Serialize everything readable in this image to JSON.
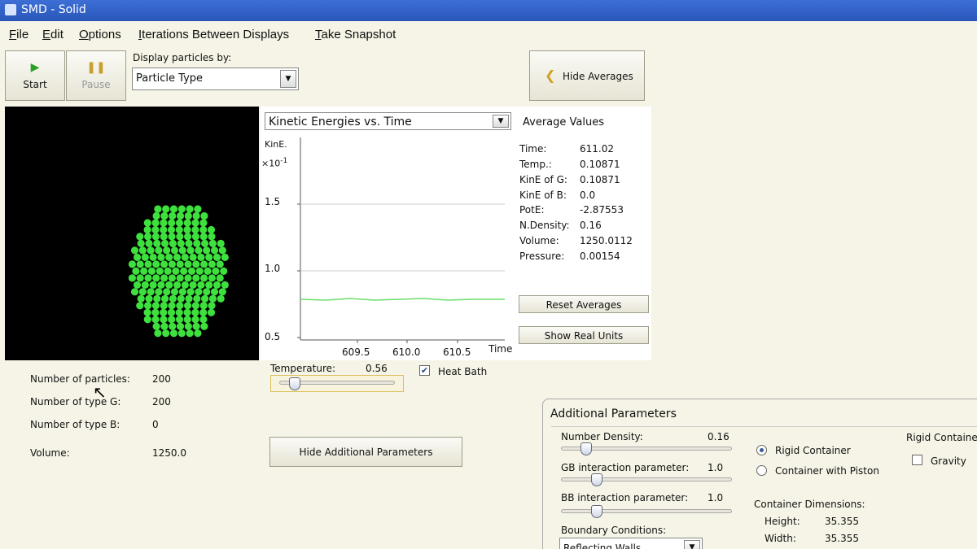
{
  "window": {
    "title": "SMD - Solid"
  },
  "menu": [
    {
      "mnemonic": "F",
      "rest": "ile"
    },
    {
      "mnemonic": "E",
      "rest": "dit"
    },
    {
      "mnemonic": "O",
      "rest": "ptions"
    },
    {
      "mnemonic": "I",
      "rest": "terations Between Displays"
    },
    {
      "mnemonic": "T",
      "rest": "ake Snapshot"
    }
  ],
  "toolbar": {
    "start_label": "Start",
    "pause_label": "Pause",
    "display_by_label": "Display particles by:",
    "display_by_value": "Particle Type",
    "hide_averages_label": "Hide Averages"
  },
  "graph": {
    "selector": "Kinetic Energies vs. Time",
    "y_title": "KinE.",
    "y_scale": "×10",
    "y_scale_exp": "-1",
    "y_ticks": [
      "1.5",
      "1.0",
      "0.5"
    ],
    "x_ticks": [
      "609.5",
      "610.0",
      "610.5"
    ],
    "x_title": "Time",
    "series_color": "#6adf6a"
  },
  "averages": {
    "title": "Average Values",
    "rows": [
      {
        "label": "Time:",
        "value": "611.02"
      },
      {
        "label": "Temp.:",
        "value": "0.10871"
      },
      {
        "label": "KinE of G:",
        "value": "0.10871"
      },
      {
        "label": "KinE of B:",
        "value": "0.0"
      },
      {
        "label": "PotE:",
        "value": "-2.87553"
      },
      {
        "label": "N.Density:",
        "value": "0.16"
      },
      {
        "label": "Volume:",
        "value": "1250.0112"
      },
      {
        "label": "Pressure:",
        "value": "0.00154"
      }
    ],
    "reset_label": "Reset Averages",
    "real_units_label": "Show Real Units"
  },
  "stats": {
    "rows": [
      {
        "label": "Number of particles:",
        "value": "200"
      },
      {
        "label": "Number of type G:",
        "value": "200"
      },
      {
        "label": "Number of type B:",
        "value": "0"
      },
      {
        "label": "Volume:",
        "value": "1250.0"
      }
    ]
  },
  "temperature": {
    "label": "Temperature:",
    "value": "0.56",
    "heat_bath_label": "Heat Bath",
    "heat_bath_checked": true
  },
  "hide_params_label": "Hide Additional Parameters",
  "params": {
    "title": "Additional Parameters",
    "number_density_label": "Number Density:",
    "number_density_value": "0.16",
    "gb_label": "GB interaction parameter:",
    "gb_value": "1.0",
    "bb_label": "BB interaction parameter:",
    "bb_value": "1.0",
    "boundary_label": "Boundary Conditions:",
    "boundary_value": "Reflecting Walls",
    "rigid_label": "Rigid Container",
    "piston_label": "Container with Piston",
    "rigid_container_header": "Rigid Containe",
    "gravity_label": "Gravity",
    "dimensions_label": "Container Dimensions:",
    "height_label": "Height:",
    "height_value": "35.355",
    "width_label": "Width:",
    "width_value": "35.355"
  },
  "colors": {
    "particle": "#3ee03e",
    "sim_bg": "#000000"
  }
}
